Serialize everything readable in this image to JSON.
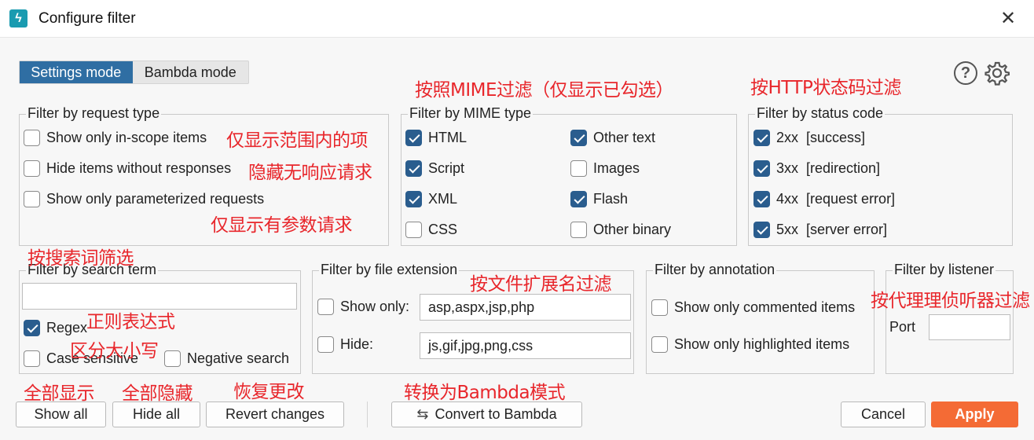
{
  "window": {
    "title": "Configure filter",
    "close_glyph": "✕",
    "app_icon": "burp-lightning-icon"
  },
  "modes": {
    "settings": "Settings mode",
    "bambda": "Bambda mode",
    "active": "settings"
  },
  "toolbar": {
    "help_glyph": "?",
    "settings_icon": "gear-icon"
  },
  "request_type": {
    "legend": "Filter by request type",
    "items": [
      {
        "label": "Show only in-scope items",
        "checked": false
      },
      {
        "label": "Hide items without responses",
        "checked": false
      },
      {
        "label": "Show only parameterized requests",
        "checked": false
      }
    ]
  },
  "mime_type": {
    "legend": "Filter by MIME type",
    "items": [
      {
        "label": "HTML",
        "checked": true
      },
      {
        "label": "Script",
        "checked": true
      },
      {
        "label": "XML",
        "checked": true
      },
      {
        "label": "CSS",
        "checked": false
      },
      {
        "label": "Other text",
        "checked": true
      },
      {
        "label": "Images",
        "checked": false
      },
      {
        "label": "Flash",
        "checked": true
      },
      {
        "label": "Other binary",
        "checked": false
      }
    ]
  },
  "status_code": {
    "legend": "Filter by status code",
    "items": [
      {
        "label": "2xx  [success]",
        "checked": true
      },
      {
        "label": "3xx  [redirection]",
        "checked": true
      },
      {
        "label": "4xx  [request error]",
        "checked": true
      },
      {
        "label": "5xx  [server error]",
        "checked": true
      }
    ]
  },
  "search_term": {
    "legend": "Filter by search term",
    "value": "",
    "regex": {
      "label": "Regex",
      "checked": true
    },
    "case_sensitive": {
      "label": "Case sensitive",
      "checked": false
    },
    "negative": {
      "label": "Negative search",
      "checked": false
    }
  },
  "file_extension": {
    "legend": "Filter by file extension",
    "show_only": {
      "label": "Show only:",
      "checked": false,
      "value": "asp,aspx,jsp,php"
    },
    "hide": {
      "label": "Hide:",
      "checked": false,
      "value": "js,gif,jpg,png,css"
    }
  },
  "annotation": {
    "legend": "Filter by annotation",
    "items": [
      {
        "label": "Show only commented items",
        "checked": false
      },
      {
        "label": "Show only highlighted items",
        "checked": false
      }
    ]
  },
  "listener": {
    "legend": "Filter by listener",
    "port_label": "Port",
    "port_value": ""
  },
  "buttons": {
    "show_all": "Show all",
    "hide_all": "Hide all",
    "revert": "Revert changes",
    "convert": "Convert to Bambda",
    "convert_icon": "swap-arrows-icon",
    "cancel": "Cancel",
    "apply": "Apply"
  },
  "annotations": {
    "mime": "按照MIME过滤（仅显示已勾选）",
    "status": "按HTTP状态码过滤",
    "in_scope": "仅显示范围内的项",
    "no_response": "隐藏无响应请求",
    "parameterized": "仅显示有参数请求",
    "search_term": "按搜索词筛选",
    "regex": "正则表达式",
    "case": "区分大小写",
    "file_ext": "按文件扩展名过滤",
    "listener": "按代理理侦听器过滤",
    "show_all": "全部显示",
    "hide_all": "全部隐藏",
    "revert": "恢复更改",
    "convert": "转换为Bambda模式"
  },
  "colors": {
    "accent": "#2f6ea3",
    "checkbox": "#2a5d8e",
    "apply": "#f46b35",
    "annotation": "#e8262b"
  }
}
